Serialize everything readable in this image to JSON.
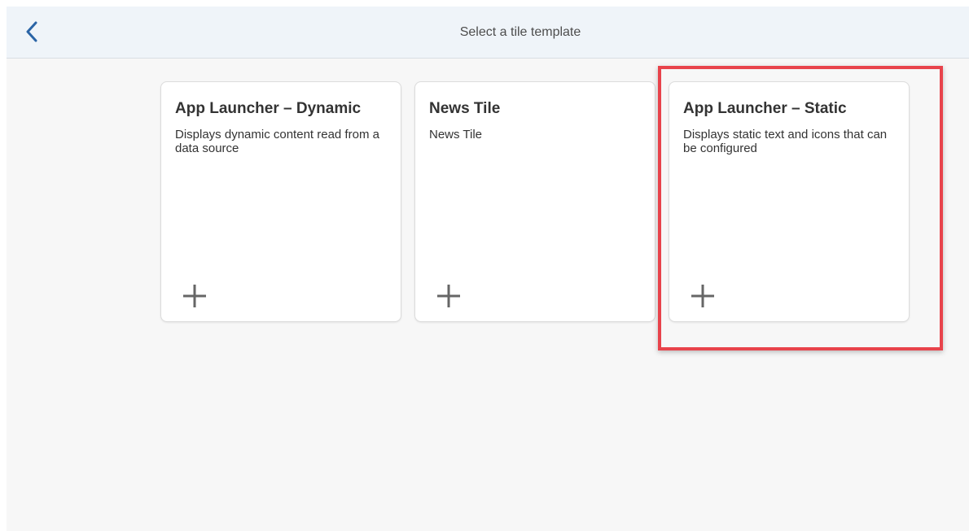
{
  "header": {
    "title": "Select a tile template",
    "back_icon": "chevron-left-icon"
  },
  "tiles": [
    {
      "title": "App Launcher – Dynamic",
      "description": "Displays dynamic content read from a data source",
      "add_icon": "plus-icon"
    },
    {
      "title": "News Tile",
      "description": "News Tile",
      "add_icon": "plus-icon"
    },
    {
      "title": "App Launcher – Static",
      "description": "Displays static text and icons that can be configured",
      "add_icon": "plus-icon"
    }
  ],
  "colors": {
    "accent": "#2a64a6",
    "highlight_border": "#e8434b",
    "header_bg": "#eff4f9",
    "page_bg": "#f7f7f7"
  }
}
